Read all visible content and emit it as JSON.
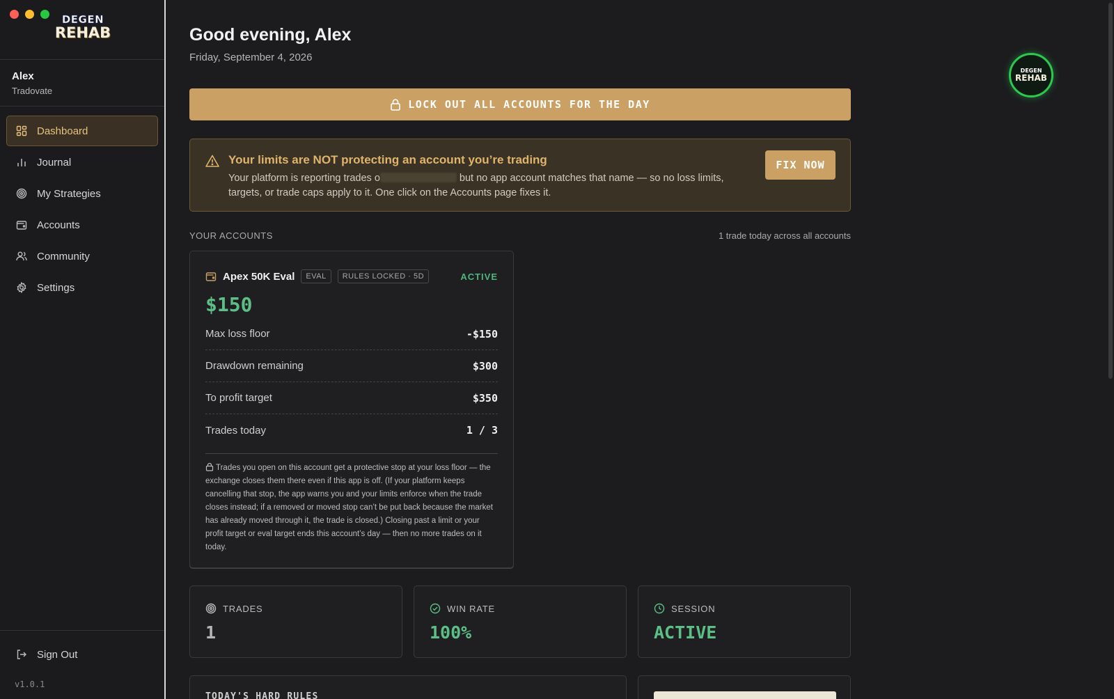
{
  "sidebar": {
    "logo_line1": "DEGEN",
    "logo_line2": "REHAB",
    "user": {
      "name": "Alex",
      "platform": "Tradovate"
    },
    "items": [
      {
        "label": "Dashboard",
        "icon": "grid-icon",
        "active": true
      },
      {
        "label": "Journal",
        "icon": "bar-chart-icon"
      },
      {
        "label": "My Strategies",
        "icon": "target-icon"
      },
      {
        "label": "Accounts",
        "icon": "wallet-icon"
      },
      {
        "label": "Community",
        "icon": "users-icon"
      },
      {
        "label": "Settings",
        "icon": "gear-icon"
      }
    ],
    "sign_out": "Sign Out",
    "version": "v1.0.1"
  },
  "header": {
    "greeting": "Good evening, Alex",
    "date": "Friday, September 4, 2026",
    "badge_line1": "DEGEN",
    "badge_line2": "REHAB"
  },
  "lockout_button": "LOCK OUT ALL ACCOUNTS FOR THE DAY",
  "alert": {
    "title": "Your limits are NOT protecting an account you’re trading",
    "body_before": "Your platform is reporting trades o",
    "body_after": " but no app account matches that name — so no loss limits, targets, or trade caps apply to it. One click on the Accounts page fixes it.",
    "fix_button": "FIX NOW"
  },
  "accounts_section": {
    "label": "YOUR ACCOUNTS",
    "summary": "1 trade today across all accounts"
  },
  "account": {
    "name": "Apex 50K Eval",
    "tag_type": "EVAL",
    "tag_rules": "RULES LOCKED · 5D",
    "status": "ACTIVE",
    "balance": "$150",
    "metrics": [
      {
        "label": "Max loss floor",
        "value": "-$150"
      },
      {
        "label": "Drawdown remaining",
        "value": "$300"
      },
      {
        "label": "To profit target",
        "value": "$350"
      },
      {
        "label": "Trades today",
        "value": "1 / 3"
      }
    ],
    "note": "Trades you open on this account get a protective stop at your loss floor — the exchange closes them there even if this app is off. (If your platform keeps cancelling that stop, the app warns you and your limits enforce when the trade closes instead; if a removed or moved stop can’t be put back because the market has already moved through it, the trade is closed.) Closing past a limit or your profit target or eval target ends this account’s day — then no more trades on it today."
  },
  "stats": [
    {
      "label": "TRADES",
      "value": "1",
      "icon": "target-icon",
      "color": "#b5b5b5"
    },
    {
      "label": "WIN RATE",
      "value": "100%",
      "icon": "check-circle-icon",
      "color": "#5cbf86"
    },
    {
      "label": "SESSION",
      "value": "ACTIVE",
      "icon": "clock-icon",
      "color": "#5cbf86"
    }
  ],
  "hard_rules": {
    "title": "TODAY'S HARD RULES"
  },
  "colors": {
    "accent": "#caa064",
    "positive": "#5cbf86",
    "status_ring": "#2bc94f",
    "background": "#1c1c1e"
  }
}
